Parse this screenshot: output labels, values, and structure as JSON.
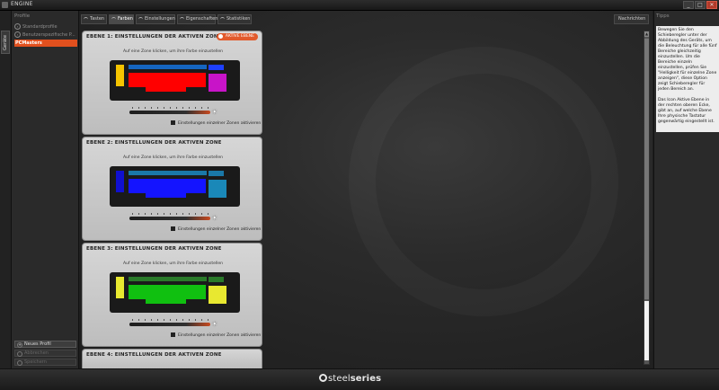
{
  "window": {
    "title": "ENGINE",
    "min": "_",
    "max": "□",
    "close": "✕"
  },
  "vtab": {
    "label": "Geräte"
  },
  "sidebar": {
    "header": "Profile",
    "items": [
      {
        "label": "Standardprofile",
        "icon": "circle-icon"
      },
      {
        "label": "Benutzerspezifische P...",
        "icon": "circle-icon"
      },
      {
        "label": "PCMasters",
        "active": true
      }
    ],
    "buttons": [
      {
        "label": "Neues Profil"
      },
      {
        "label": "Abbrechen"
      },
      {
        "label": "Speichern"
      }
    ]
  },
  "tabs": [
    {
      "label": "Tasten"
    },
    {
      "label": "Farben",
      "active": true
    },
    {
      "label": "Einstellungen"
    },
    {
      "label": "Eigenschaften"
    },
    {
      "label": "Statistiken"
    }
  ],
  "notifications_label": "Nachrichten",
  "panels": [
    {
      "title": "EBENE 1: EINSTELLUNGEN DER AKTIVEN ZONE",
      "badge": "AKTIVE EBENE",
      "instruction": "Auf eine Zone klicken, um ihre Farbe einzustellen",
      "checkbox": "Einstellungen einzelner Zonen aktivieren",
      "brightness": 1.0,
      "zones": {
        "left": "#f5c400",
        "top_bar": "#1565c0",
        "main": "#ff0000",
        "bottom": "#ff0000",
        "right_top": "#1e40ff",
        "right": "#c814c8"
      }
    },
    {
      "title": "EBENE 2: EINSTELLUNGEN DER AKTIVEN ZONE",
      "instruction": "Auf eine Zone klicken, um ihre Farbe einzustellen",
      "checkbox": "Einstellungen einzelner Zonen aktivieren",
      "brightness": 1.0,
      "zones": {
        "left": "#1010d0",
        "top_bar": "#1a78a8",
        "main": "#1414ff",
        "bottom": "#1414ff",
        "right_top": "#1a78a8",
        "right": "#1a88b8"
      }
    },
    {
      "title": "EBENE 3: EINSTELLUNGEN DER AKTIVEN ZONE",
      "instruction": "Auf eine Zone klicken, um ihre Farbe einzustellen",
      "checkbox": "Einstellungen einzelner Zonen aktivieren",
      "brightness": 1.0,
      "zones": {
        "left": "#e8e830",
        "top_bar": "#2a7a2a",
        "main": "#10c010",
        "bottom": "#10c010",
        "right_top": "#2a7a2a",
        "right": "#e8e830"
      }
    },
    {
      "title": "EBENE 4: EINSTELLUNGEN DER AKTIVEN ZONE"
    }
  ],
  "tips": {
    "header": "Tipps",
    "paragraphs": [
      "Bewegen Sie den Schieberegler unter der Abbildung des Geräts, um die Beleuchtung für alle fünf Bereiche gleichzeitig einzustellen. Um die Bereiche einzeln einzustellen, prüfen Sie \"Helligkeit für einzelne Zone anzeigen\", diese Option zeigt Schieberegler für jeden Bereich an.",
      "Das Icon Aktive Ebene in der rechten oberen Ecke, gibt an, auf welche Ebene Ihre physische Tastatur gegenwärtig eingestellt ist."
    ]
  },
  "footer": {
    "logo_light": "steel",
    "logo_bold": "series"
  }
}
